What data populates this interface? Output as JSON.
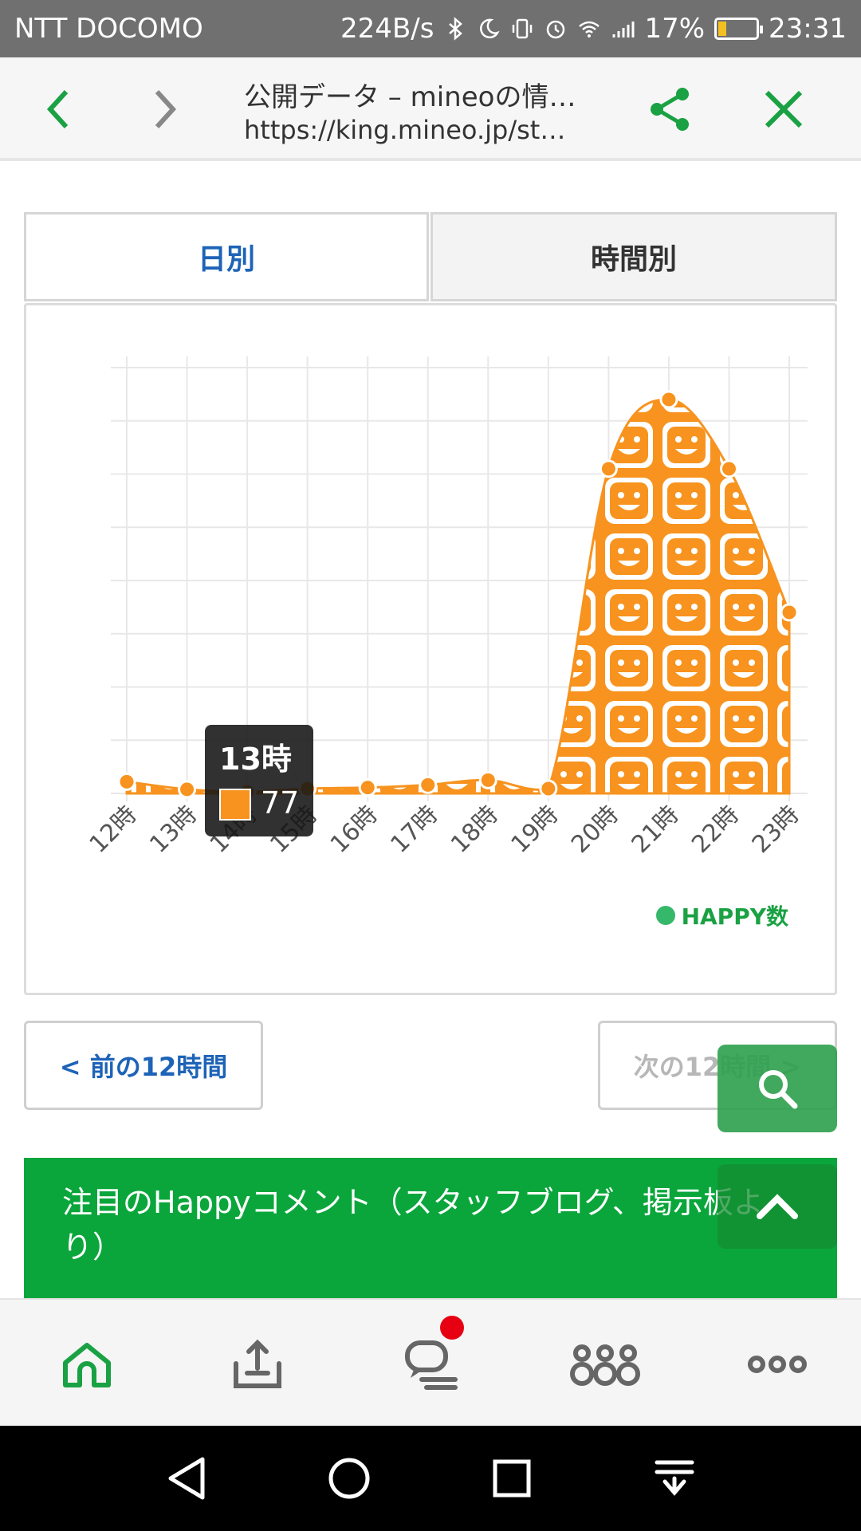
{
  "status_bar": {
    "carrier": "NTT DOCOMO",
    "net_speed": "224B/s",
    "battery_percent": "17%",
    "time": "23:31",
    "icons": [
      "bluetooth-icon",
      "moon-icon",
      "vibrate-icon",
      "alarm-icon",
      "wifi-icon",
      "signal-icon",
      "battery-icon"
    ]
  },
  "browser": {
    "title": "公開データ – mineoの情…",
    "url": "https://king.mineo.jp/st…",
    "icons": [
      "back-icon",
      "forward-icon",
      "share-icon",
      "close-icon"
    ]
  },
  "tabs": [
    {
      "label": "日別",
      "active": true
    },
    {
      "label": "時間別",
      "active": false
    }
  ],
  "chart_data": {
    "type": "area",
    "x": [
      "12時",
      "13時",
      "14時",
      "15時",
      "16時",
      "17時",
      "18時",
      "19時",
      "20時",
      "21時",
      "22時",
      "23時"
    ],
    "series": [
      {
        "name": "HAPPY数",
        "values": [
          220,
          77,
          30,
          90,
          110,
          160,
          250,
          90,
          6100,
          7400,
          6100,
          3400
        ]
      }
    ],
    "ylim": [
      0,
      8000
    ],
    "grid": true,
    "legend": "bottom-right",
    "fill_color": "#f7931e",
    "legend_color": "#36b86a",
    "tooltip": {
      "label": "13時",
      "value": "77"
    }
  },
  "pager": {
    "prev_label": "< 前の12時間",
    "next_label": "次の12時間 >"
  },
  "banner": {
    "text": "注目のHappyコメント（スタッフブログ、掲示板より）"
  },
  "app_nav": {
    "icons": [
      "home-icon",
      "upload-icon",
      "chat-icon",
      "group-icon",
      "more-icon"
    ]
  },
  "system_nav": {
    "icons": [
      "system-back-icon",
      "system-home-icon",
      "system-recents-icon",
      "notification-pull-icon"
    ]
  },
  "colors": {
    "accent_green": "#1aa143",
    "link_blue": "#1d63b7",
    "chart_orange": "#f7931e",
    "badge_red": "#e60012"
  }
}
